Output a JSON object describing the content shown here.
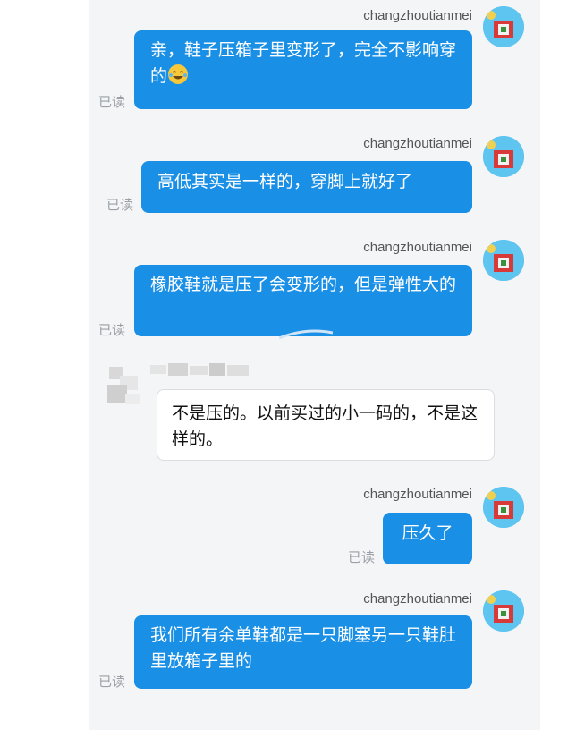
{
  "messages": [
    {
      "sender": "changzhoutianmei",
      "text": "亲，鞋子压箱子里变形了，完全不影响穿的",
      "emoji": "laughing-tears-icon",
      "read": "已读"
    },
    {
      "sender": "changzhoutianmei",
      "text": "高低其实是一样的，穿脚上就好了",
      "read": "已读"
    },
    {
      "sender": "changzhoutianmei",
      "text": "橡胶鞋就是压了会变形的，但是弹性大的",
      "read": "已读"
    },
    {
      "text": "不是压的。以前买过的小一码的，不是这样的。"
    },
    {
      "sender": "changzhoutianmei",
      "text": "压久了",
      "read": "已读"
    },
    {
      "sender": "changzhoutianmei",
      "text": "我们所有余单鞋都是一只脚塞另一只鞋肚里放箱子里的",
      "read": "已读"
    }
  ],
  "colors": {
    "outgoing_bubble": "#1a8fe6",
    "panel": "#f4f5f7",
    "read_label": "#9aa0a6"
  }
}
